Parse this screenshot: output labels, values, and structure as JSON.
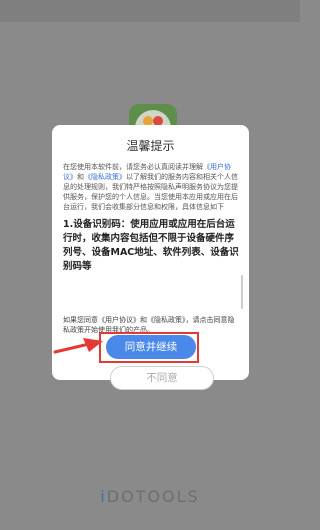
{
  "dialog": {
    "title": "温馨提示",
    "intro_prefix": "在您使用本软件前，请您务必认真阅读并理解",
    "user_agreement_link": "《用户协议》",
    "and_text": "和",
    "privacy_policy_link": "《隐私政策》",
    "intro_suffix": "以了解我们的服务内容和相关个人信息的处理规则，我们特严格按照隐私声明服务协议为您提供服务，保护您的个人信息。当您使用本应用或应用在后台运行，我们会收集部分信息和权限，具体信息如下",
    "section_heading": "1.设备识别码：使用应用或应用在后台运行时，收集内容包括但不限于设备硬件序列号、设备MAC地址、软件列表、设备识别码等",
    "footer_text": "如果您同意《用户协议》和《隐私政策》，请点击同意隐私政策开始使用我们的产品。",
    "agree_label": "同意并继续",
    "decline_label": "不同意"
  },
  "background": {
    "brand_prefix": "i",
    "brand_rest": "DOTOOLS"
  },
  "colors": {
    "accent": "#4a88ea",
    "link": "#3a6fd8",
    "highlight": "#e53935",
    "overlay": "#8a8a8a"
  },
  "icons": {
    "app": "app-logo-icon",
    "arrow": "annotation-arrow-icon"
  }
}
